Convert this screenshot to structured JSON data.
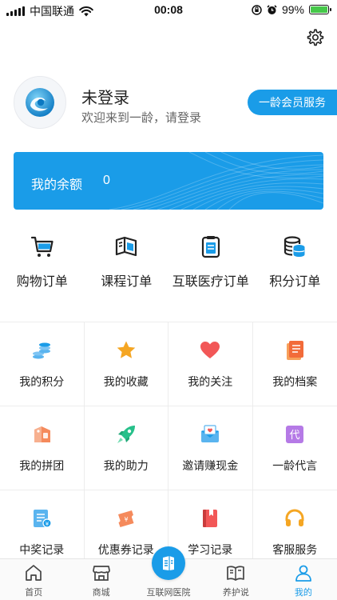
{
  "status_bar": {
    "carrier": "中国联通",
    "time": "00:08",
    "battery": "99%",
    "battery_level": 0.99
  },
  "header": {
    "settings_icon": "gear-icon"
  },
  "profile": {
    "name": "未登录",
    "welcome": "欢迎来到一龄，请登录",
    "member_button": "一龄会员服务"
  },
  "balance": {
    "label": "我的余额",
    "amount": "0"
  },
  "orders": [
    {
      "label": "购物订单",
      "icon": "cart-icon"
    },
    {
      "label": "课程订单",
      "icon": "book-icon"
    },
    {
      "label": "互联医疗订单",
      "icon": "clipboard-icon"
    },
    {
      "label": "积分订单",
      "icon": "coins-icon"
    }
  ],
  "grid": [
    {
      "label": "我的积分",
      "icon": "coins-stack-icon"
    },
    {
      "label": "我的收藏",
      "icon": "star-icon"
    },
    {
      "label": "我的关注",
      "icon": "heart-icon"
    },
    {
      "label": "我的档案",
      "icon": "file-icon"
    },
    {
      "label": "我的拼团",
      "icon": "group-tag-icon"
    },
    {
      "label": "我的助力",
      "icon": "rocket-icon"
    },
    {
      "label": "邀请赚现金",
      "icon": "envelope-icon"
    },
    {
      "label": "一龄代言",
      "icon": "endorse-icon"
    },
    {
      "label": "中奖记录",
      "icon": "receipt-icon"
    },
    {
      "label": "优惠券记录",
      "icon": "coupon-icon"
    },
    {
      "label": "学习记录",
      "icon": "study-book-icon"
    },
    {
      "label": "客服服务",
      "icon": "headset-icon"
    }
  ],
  "tabbar": [
    {
      "label": "首页",
      "icon": "home-icon"
    },
    {
      "label": "商城",
      "icon": "store-icon"
    },
    {
      "label": "互联网医院",
      "icon": "hospital-icon"
    },
    {
      "label": "养护说",
      "icon": "open-book-icon"
    },
    {
      "label": "我的",
      "icon": "user-icon"
    }
  ],
  "colors": {
    "accent": "#1a9ce8",
    "orange": "#f5a623",
    "red": "#f25757",
    "green": "#27c08a",
    "purple": "#b57ae6"
  }
}
